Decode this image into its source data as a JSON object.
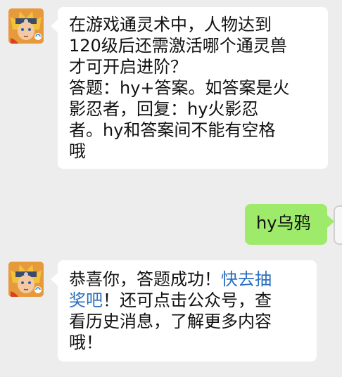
{
  "messages": [
    {
      "sender": "official",
      "lines": [
        "在游戏通灵术中，人物达到",
        "120级后还需激活哪个通灵兽",
        "才可开启进阶？",
        "答题：hy+答案。如答案是火",
        "影忍者，回复：hy火影忍",
        "者。hy和答案间不能有空格",
        "哦"
      ]
    },
    {
      "sender": "me",
      "text": "hy乌鸦"
    },
    {
      "sender": "official",
      "line1_before": "恭喜你，答题成功！",
      "line1_link": "快去抽",
      "line2_link": "奖吧",
      "line2_after": "！还可点击公众号，查",
      "line3": "看历史消息，了解更多内容",
      "line4": "哦！"
    }
  ],
  "colors": {
    "background": "#ededed",
    "incoming_bubble": "#ffffff",
    "outgoing_bubble": "#9eea6a",
    "link": "#2b6fbf"
  }
}
